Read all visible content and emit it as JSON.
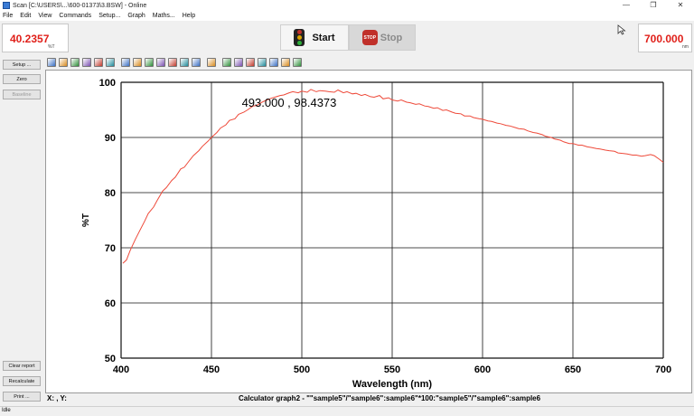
{
  "window": {
    "title": "Scan [C:\\USERS\\...\\600-01373\\3.BSW] - Online",
    "controls": [
      "—",
      "❐",
      "✕"
    ]
  },
  "menu": [
    "File",
    "Edit",
    "View",
    "Commands",
    "Setup...",
    "Graph",
    "Maths...",
    "Help"
  ],
  "readouts": {
    "left_value": "40.2357",
    "left_unit": "%T",
    "right_value": "700.000",
    "right_unit": "nm"
  },
  "controls": {
    "start_label": "Start",
    "stop_label": "Stop",
    "stop_sign_text": "STOP"
  },
  "sidebar": {
    "top_buttons": [
      "Setup ...",
      "Zero",
      "Baseline"
    ],
    "bottom_buttons": [
      "Clear report",
      "Recalculate",
      "Print ..."
    ]
  },
  "toolbar": {
    "icons": [
      "autoscale-icon",
      "zoom-icon",
      "pointer-icon",
      "crosshair-icon",
      "track-icon",
      "xy-scale-icon",
      "search-icon",
      "peak-icon",
      "overlay-icon",
      "table-icon",
      "list-icon",
      "graph-icon",
      "export-icon",
      "delete-icon",
      "scale-icon",
      "axis-icon",
      "color-icon",
      "image-icon",
      "stats-icon",
      "line-icon",
      "save-icon"
    ]
  },
  "status": {
    "coords": "X: , Y:",
    "calc": "Calculator graph2 - \"\"sample5\"/\"sample6\":sample6\"*100:\"sample5\"/\"sample6\":sample6",
    "bar": "Idle"
  },
  "colors": {
    "readout": "#e0201a",
    "trace": "#ee4a3a"
  },
  "chart_data": {
    "type": "line",
    "xlabel": "Wavelength (nm)",
    "ylabel": "%T",
    "xlim": [
      400,
      700
    ],
    "ylim": [
      50,
      100
    ],
    "xticks": [
      400,
      450,
      500,
      550,
      600,
      650,
      700
    ],
    "yticks": [
      50,
      60,
      70,
      80,
      90,
      100
    ],
    "grid": true,
    "annotation": "493.000 , 98.4373",
    "series": [
      {
        "x": [
          401,
          403,
          405,
          408,
          410,
          413,
          415,
          418,
          420,
          423,
          425,
          428,
          430,
          433,
          435,
          438,
          440,
          443,
          445,
          448,
          450,
          453,
          455,
          458,
          460,
          463,
          465,
          468,
          470,
          473,
          475,
          478,
          480,
          483,
          485,
          488,
          490,
          493,
          495,
          498,
          500,
          503,
          505,
          508,
          510,
          513,
          515,
          518,
          520,
          523,
          525,
          528,
          530,
          533,
          535,
          538,
          540,
          543,
          545,
          548,
          550,
          553,
          555,
          558,
          560,
          563,
          565,
          568,
          570,
          573,
          575,
          578,
          580,
          583,
          585,
          588,
          590,
          593,
          595,
          598,
          600,
          603,
          605,
          608,
          610,
          613,
          615,
          618,
          620,
          623,
          625,
          628,
          630,
          633,
          635,
          638,
          640,
          643,
          645,
          648,
          650,
          653,
          655,
          658,
          660,
          663,
          665,
          668,
          670,
          673,
          675,
          678,
          680,
          683,
          685,
          688,
          690,
          693,
          695,
          698,
          700
        ],
        "y": [
          67.2,
          67.8,
          69.5,
          71.6,
          72.9,
          74.8,
          76.2,
          77.4,
          78.6,
          80.3,
          80.9,
          82.2,
          82.8,
          84.3,
          84.6,
          85.9,
          86.7,
          87.6,
          88.4,
          89.3,
          90.0,
          90.9,
          91.7,
          92.3,
          93.1,
          93.4,
          94.2,
          94.6,
          95.0,
          95.7,
          95.8,
          96.4,
          96.7,
          97.1,
          97.3,
          97.6,
          97.7,
          98.1,
          98.3,
          98.1,
          98.4,
          98.2,
          98.7,
          98.3,
          98.5,
          98.4,
          98.3,
          98.2,
          98.6,
          98.1,
          98.3,
          97.9,
          98.0,
          97.6,
          97.8,
          97.4,
          97.3,
          97.6,
          97.0,
          97.2,
          96.8,
          96.6,
          96.8,
          96.4,
          96.3,
          96.0,
          96.1,
          95.7,
          95.6,
          95.3,
          95.4,
          94.9,
          95.0,
          94.6,
          94.4,
          94.3,
          93.9,
          93.9,
          93.6,
          93.4,
          93.3,
          93.0,
          92.9,
          92.6,
          92.5,
          92.2,
          92.1,
          91.8,
          91.6,
          91.5,
          91.2,
          90.9,
          90.8,
          90.5,
          90.2,
          90.0,
          89.7,
          89.5,
          89.2,
          88.9,
          88.9,
          88.6,
          88.6,
          88.3,
          88.2,
          88.0,
          87.9,
          87.7,
          87.6,
          87.5,
          87.2,
          87.1,
          87.0,
          86.8,
          86.8,
          86.6,
          86.7,
          86.9,
          86.7,
          86.0,
          85.5
        ]
      }
    ]
  }
}
